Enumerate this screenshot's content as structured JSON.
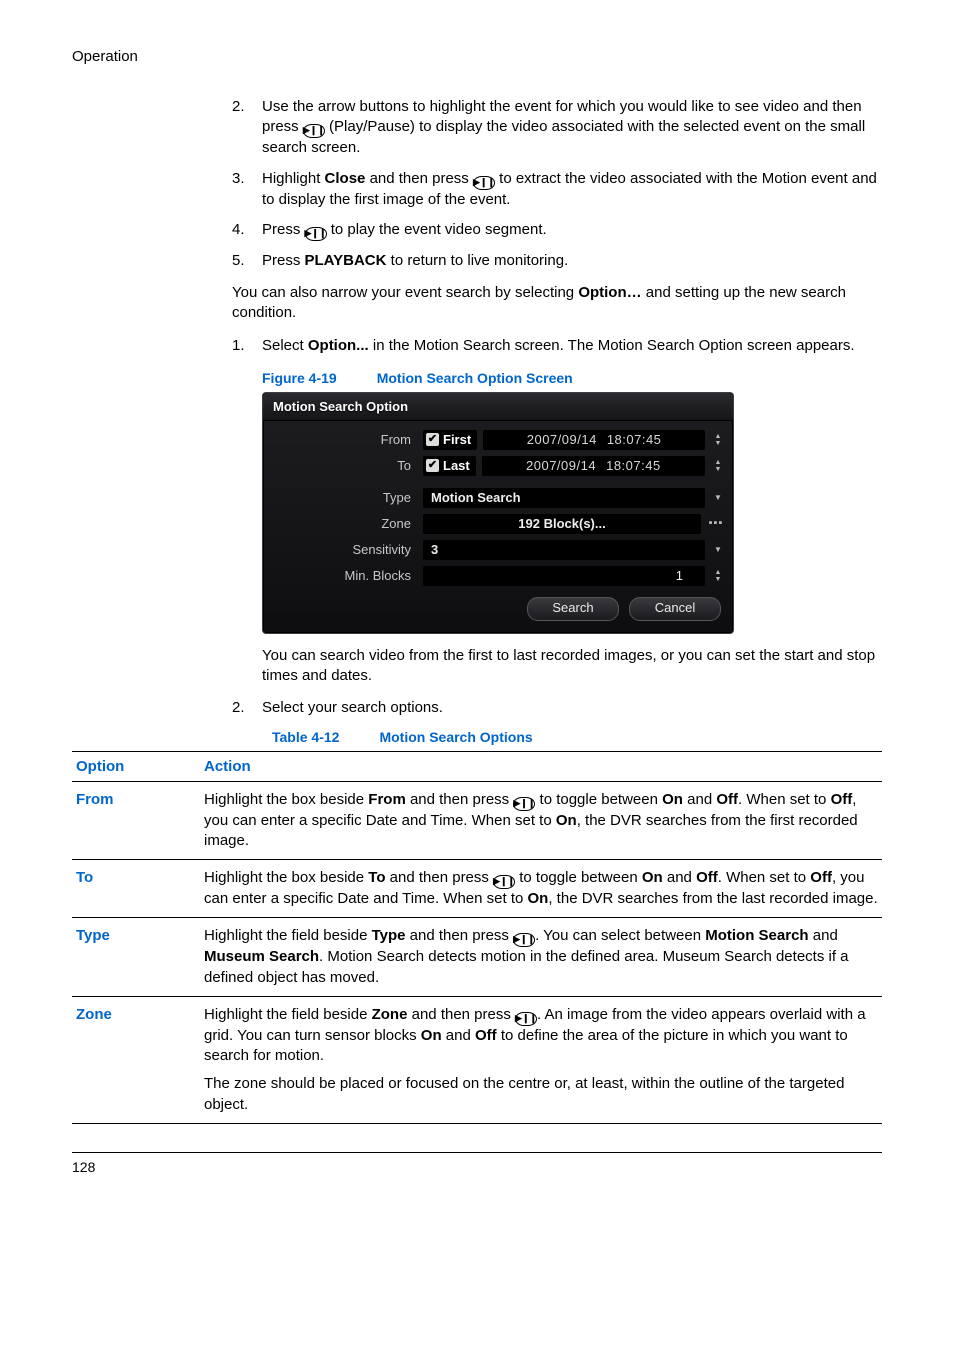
{
  "header": {
    "section": "Operation"
  },
  "steps_a": [
    {
      "num": "2.",
      "before": "Use the arrow buttons to highlight the event for which you would like to see video and then press ",
      "after": " (Play/Pause) to display the video associated with the selected event on the small search screen."
    },
    {
      "num": "3.",
      "pre": "Highlight ",
      "bold1": "Close",
      "mid": " and then press ",
      "post": " to extract the video associated with the Motion event and to display the first image of the event."
    },
    {
      "num": "4.",
      "pre": "Press ",
      "post": " to play the event video segment."
    },
    {
      "num": "5.",
      "pre": "Press ",
      "bold1": "PLAYBACK",
      "post": " to return to live monitoring."
    }
  ],
  "mid_para": {
    "pre": "You can also narrow your event search by selecting ",
    "bold": "Option…",
    "post": " and setting up the new search condition."
  },
  "steps_b": [
    {
      "num": "1.",
      "pre": "Select ",
      "bold1": "Option...",
      "post": " in the Motion Search screen. The Motion Search Option screen appears."
    }
  ],
  "figure": {
    "num": "Figure 4-19",
    "title": "Motion Search Option Screen"
  },
  "dialog": {
    "title": "Motion Search Option",
    "from_label": "From",
    "to_label": "To",
    "first": "First",
    "last": "Last",
    "date": "2007/09/14",
    "time": "18:07:45",
    "type_label": "Type",
    "type_value": "Motion Search",
    "zone_label": "Zone",
    "zone_value": "192 Block(s)...",
    "sens_label": "Sensitivity",
    "sens_value": "3",
    "min_label": "Min. Blocks",
    "min_value": "1",
    "search_btn": "Search",
    "cancel_btn": "Cancel"
  },
  "post_fig_para": "You can search video from the first to last recorded images, or you can set the start and stop times and dates.",
  "steps_c": [
    {
      "num": "2.",
      "text": "Select your search options."
    }
  ],
  "table_caption": {
    "num": "Table 4-12",
    "title": "Motion Search Options"
  },
  "table": {
    "col_option": "Option",
    "col_action": "Action",
    "rows": {
      "from": {
        "name": "From",
        "p1_pre": "Highlight the box beside ",
        "p1_b1": "From",
        "p1_mid": " and then press ",
        "p1_post": " to toggle between ",
        "p1_b2": "On",
        "p1_and": " and ",
        "p1_b3": "Off",
        "p1_end": ". When set to ",
        "p1_b4": "Off",
        "p1_after1": ", you can enter a specific Date and Time. When set to ",
        "p1_b5": "On",
        "p1_after2": ", the DVR searches from the first recorded image."
      },
      "to": {
        "name": "To",
        "p1_pre": "Highlight the box beside ",
        "p1_b1": "To",
        "p1_mid": " and then press ",
        "p1_post": " to toggle between ",
        "p1_b2": "On",
        "p1_and": " and ",
        "p1_b3": "Off",
        "p1_end": ". When set to ",
        "p1_b4": "Off",
        "p1_after1": ", you can enter a specific Date and Time. When set to ",
        "p1_b5": "On",
        "p1_after2": ", the DVR searches from the last recorded image."
      },
      "type": {
        "name": "Type",
        "p1_pre": "Highlight the field beside ",
        "p1_b1": "Type",
        "p1_mid": " and then press ",
        "p1_post": ". You can select between ",
        "p1_b2": "Motion Search",
        "p1_and": " and ",
        "p1_b3": "Museum Search",
        "p1_end": ". Motion Search detects motion in the defined area. Museum Search detects if a defined object has moved."
      },
      "zone": {
        "name": "Zone",
        "p1_pre": "Highlight the field beside ",
        "p1_b1": "Zone",
        "p1_mid": " and then press ",
        "p1_post": ". An image from the video appears overlaid with a grid. You can turn sensor blocks ",
        "p1_b2": "On",
        "p1_and": " and ",
        "p1_b3": "Off",
        "p1_end": " to define the area of the picture in which you want to search for motion.",
        "p2": "The zone should be placed or focused on the centre or, at least, within the outline of the targeted object."
      }
    }
  },
  "icon_glyph": "▸",
  "pause_glyph": "❚❚",
  "footer": {
    "page": "128"
  }
}
